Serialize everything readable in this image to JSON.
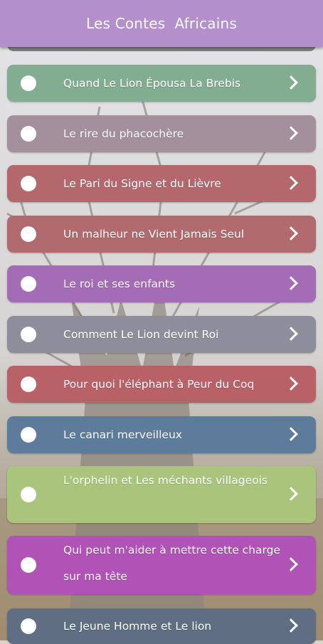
{
  "header": {
    "title": "Les Contes  Africains",
    "color": "#b38fcc"
  },
  "stories": [
    {
      "title": "Quand Le Lion Épousa La Brebis",
      "color": "#82ad90"
    },
    {
      "title": "Le rire du phacochère",
      "color": "#a48f9c"
    },
    {
      "title": "Le Pari du Signe et du Lièvre",
      "color": "#b4686c"
    },
    {
      "title": "Un malheur ne Vient Jamais Seul",
      "color": "#b16a6e"
    },
    {
      "title": "Le roi et ses enfants",
      "color": "#a56cb6"
    },
    {
      "title": "Comment Le Lion devint Roi",
      "color": "#8e8d9c"
    },
    {
      "title": "Pour quoi l'éléphant à Peur du Coq",
      "color": "#b86167"
    },
    {
      "title": "Le canari merveilleux",
      "color": "#5d7c9b"
    },
    {
      "title": "L'orphelin et Les méchants villageois",
      "color": "#a9c57c"
    },
    {
      "title": "Qui peut m'aider à mettre cette charge sur ma tête",
      "color": "#b152b6"
    },
    {
      "title": "Le Jeune Homme et Le lion",
      "color": "#5f6e82"
    }
  ],
  "icons": {
    "selector": "radio-circle-icon",
    "arrow": "chevron-right-icon"
  }
}
